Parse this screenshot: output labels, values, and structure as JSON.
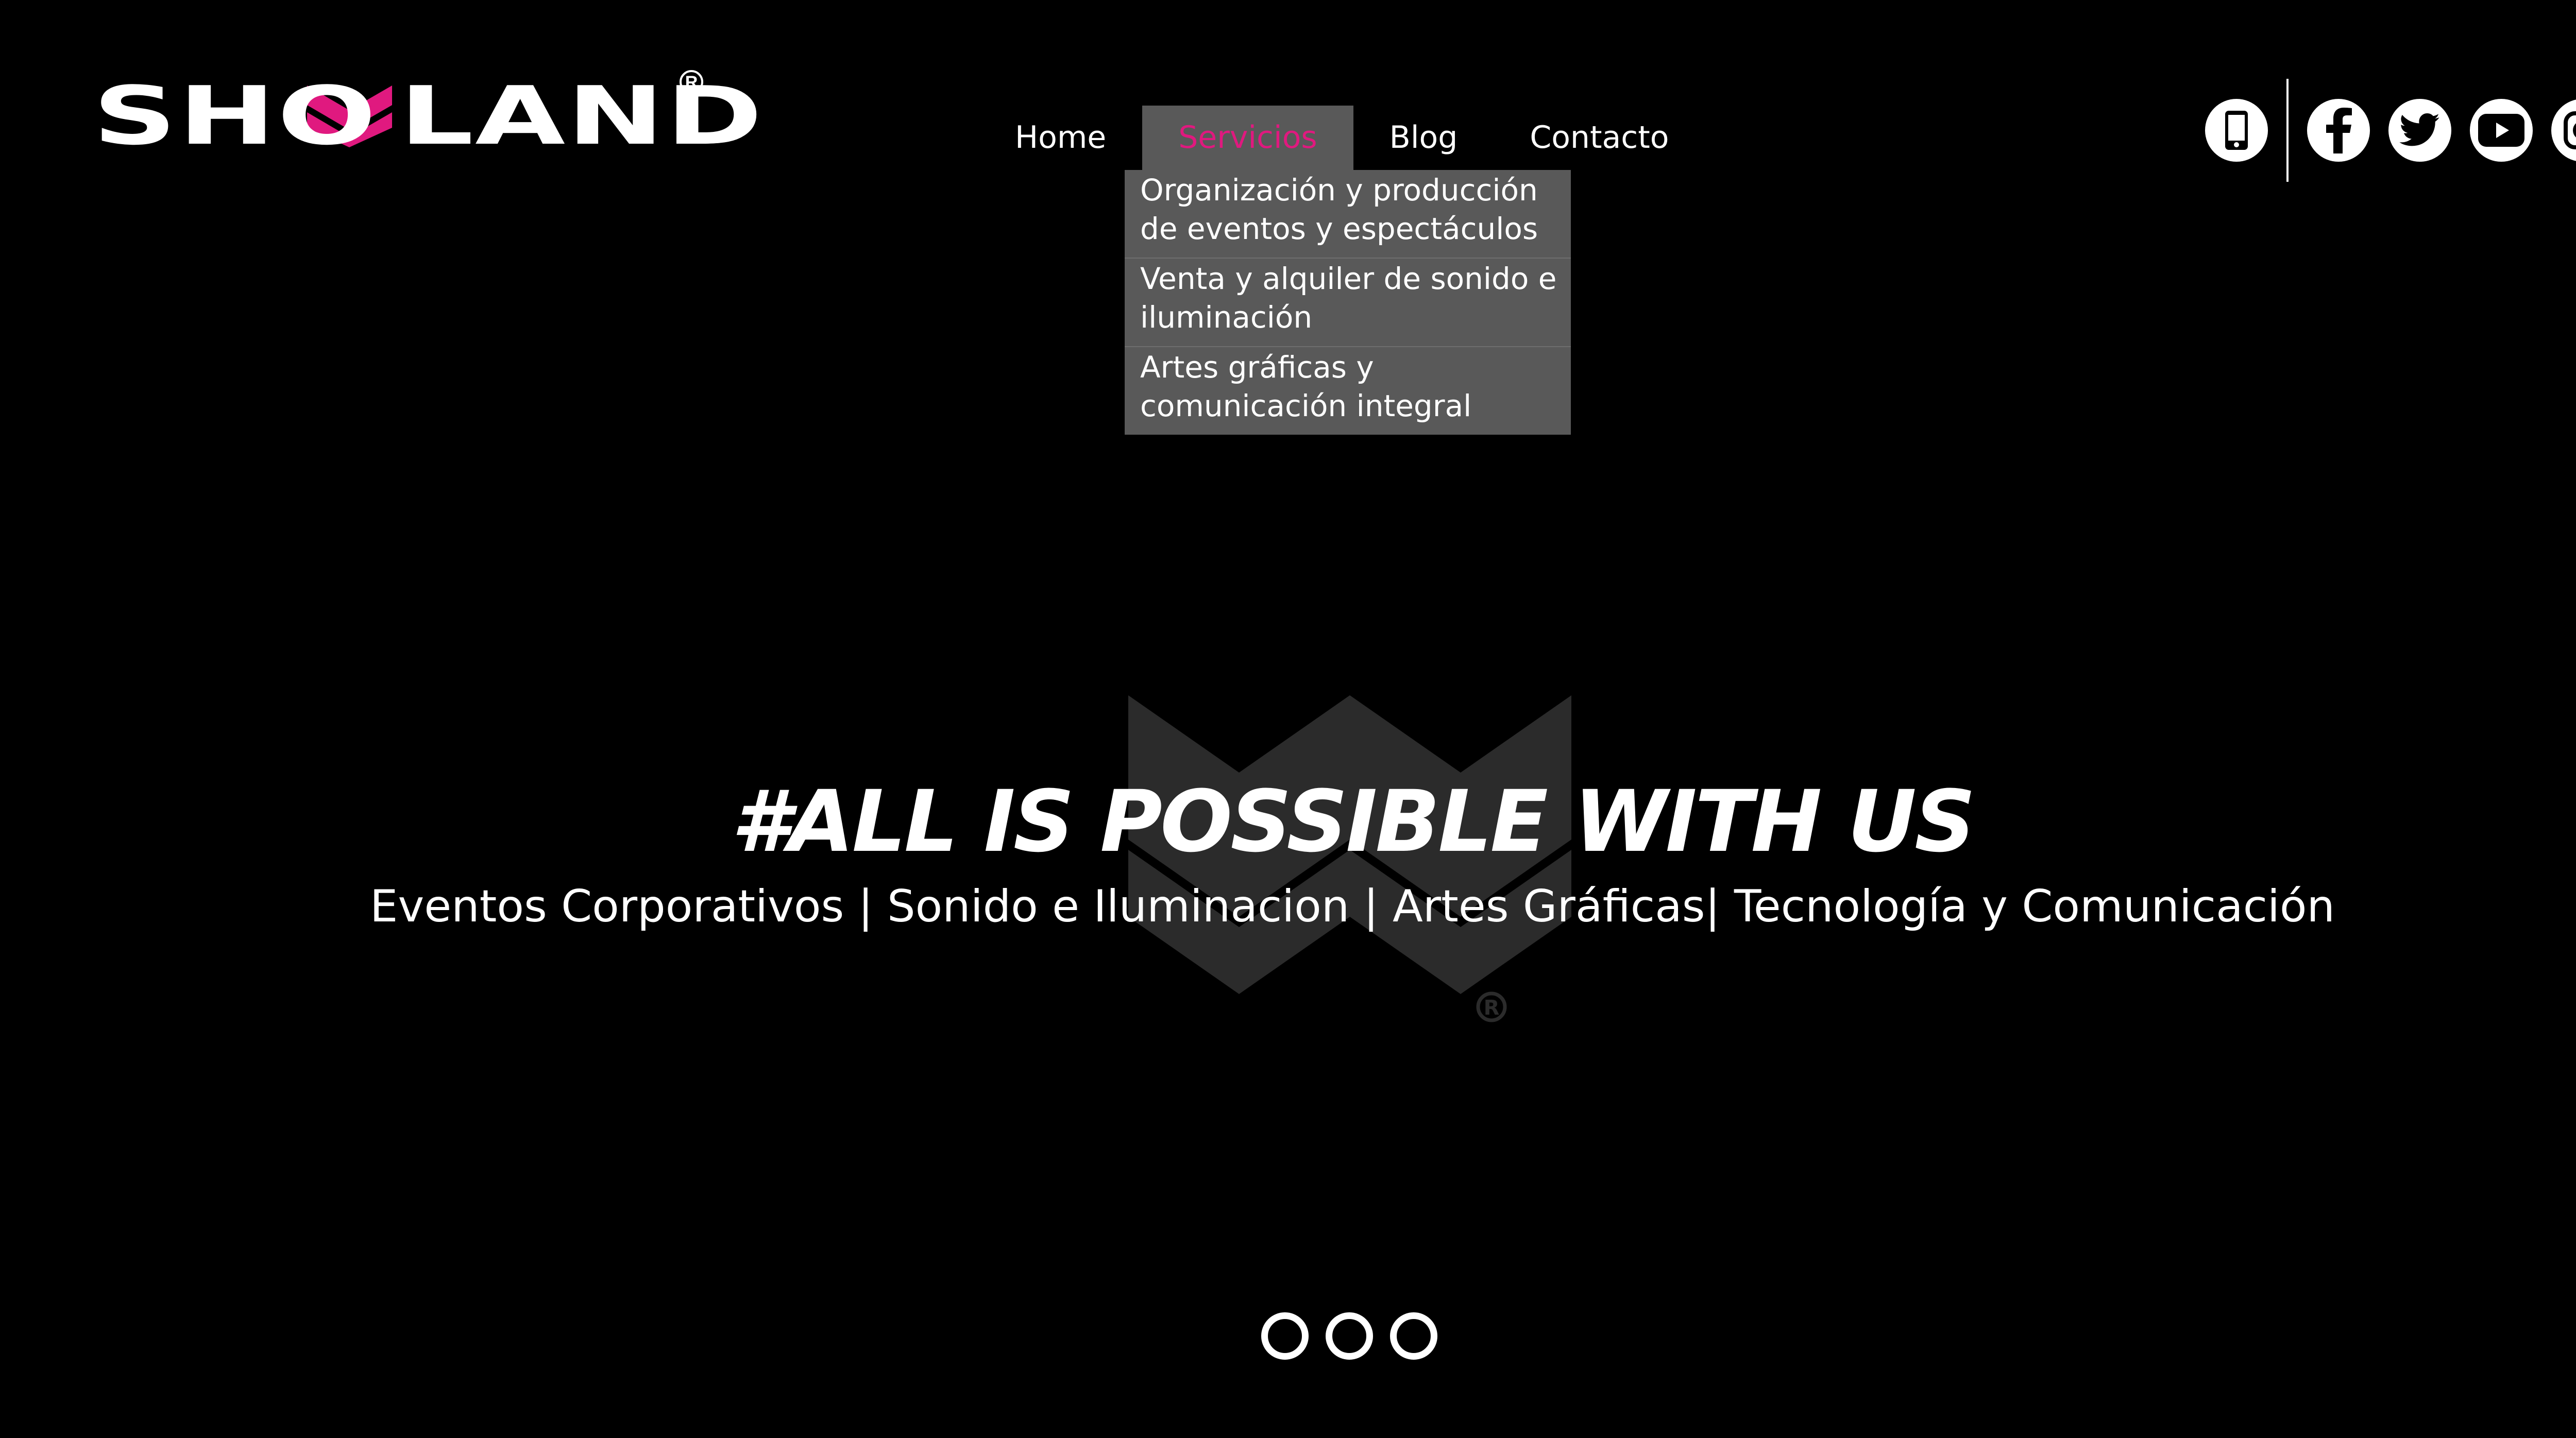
{
  "logo": {
    "left": "SHO",
    "right": "LAND",
    "registered": "R",
    "accent_color": "#e0197f"
  },
  "nav": {
    "items": [
      {
        "label": "Home"
      },
      {
        "label": "Servicios"
      },
      {
        "label": "Blog"
      },
      {
        "label": "Contacto"
      }
    ],
    "active_color": "#e0197f",
    "active_bg": "#595959"
  },
  "dropdown": {
    "items": [
      {
        "line1": "Organización y producción",
        "line2": "de eventos y espectáculos"
      },
      {
        "line1": "Venta y alquiler de sonido e",
        "line2": "iluminación"
      },
      {
        "line1": "Artes gráficas y",
        "line2": "comunicación  integral"
      }
    ]
  },
  "social": {
    "icons": [
      "phone-icon",
      "facebook-icon",
      "twitter-icon",
      "youtube-icon",
      "instagram-icon"
    ]
  },
  "hero": {
    "title": "#ALL IS POSSIBLE WITH US",
    "subtitle": "Eventos Corporativos  |  Sonido e Iluminacion  |  Artes Gráficas|  Tecnología y Comunicación",
    "watermark_registered": "R"
  },
  "slider": {
    "dots": 3
  }
}
